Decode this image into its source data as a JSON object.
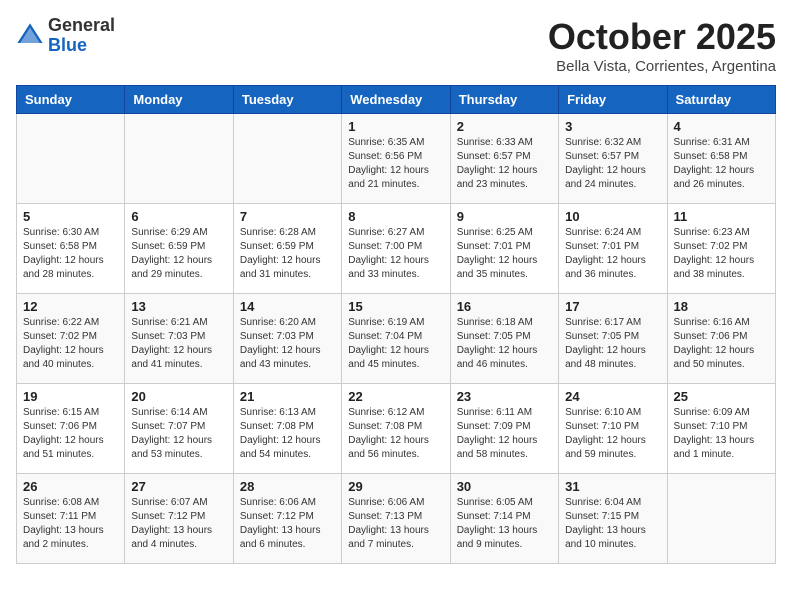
{
  "header": {
    "logo_line1": "General",
    "logo_line2": "Blue",
    "month": "October 2025",
    "location": "Bella Vista, Corrientes, Argentina"
  },
  "weekdays": [
    "Sunday",
    "Monday",
    "Tuesday",
    "Wednesday",
    "Thursday",
    "Friday",
    "Saturday"
  ],
  "weeks": [
    [
      {
        "day": "",
        "info": ""
      },
      {
        "day": "",
        "info": ""
      },
      {
        "day": "",
        "info": ""
      },
      {
        "day": "1",
        "info": "Sunrise: 6:35 AM\nSunset: 6:56 PM\nDaylight: 12 hours\nand 21 minutes."
      },
      {
        "day": "2",
        "info": "Sunrise: 6:33 AM\nSunset: 6:57 PM\nDaylight: 12 hours\nand 23 minutes."
      },
      {
        "day": "3",
        "info": "Sunrise: 6:32 AM\nSunset: 6:57 PM\nDaylight: 12 hours\nand 24 minutes."
      },
      {
        "day": "4",
        "info": "Sunrise: 6:31 AM\nSunset: 6:58 PM\nDaylight: 12 hours\nand 26 minutes."
      }
    ],
    [
      {
        "day": "5",
        "info": "Sunrise: 6:30 AM\nSunset: 6:58 PM\nDaylight: 12 hours\nand 28 minutes."
      },
      {
        "day": "6",
        "info": "Sunrise: 6:29 AM\nSunset: 6:59 PM\nDaylight: 12 hours\nand 29 minutes."
      },
      {
        "day": "7",
        "info": "Sunrise: 6:28 AM\nSunset: 6:59 PM\nDaylight: 12 hours\nand 31 minutes."
      },
      {
        "day": "8",
        "info": "Sunrise: 6:27 AM\nSunset: 7:00 PM\nDaylight: 12 hours\nand 33 minutes."
      },
      {
        "day": "9",
        "info": "Sunrise: 6:25 AM\nSunset: 7:01 PM\nDaylight: 12 hours\nand 35 minutes."
      },
      {
        "day": "10",
        "info": "Sunrise: 6:24 AM\nSunset: 7:01 PM\nDaylight: 12 hours\nand 36 minutes."
      },
      {
        "day": "11",
        "info": "Sunrise: 6:23 AM\nSunset: 7:02 PM\nDaylight: 12 hours\nand 38 minutes."
      }
    ],
    [
      {
        "day": "12",
        "info": "Sunrise: 6:22 AM\nSunset: 7:02 PM\nDaylight: 12 hours\nand 40 minutes."
      },
      {
        "day": "13",
        "info": "Sunrise: 6:21 AM\nSunset: 7:03 PM\nDaylight: 12 hours\nand 41 minutes."
      },
      {
        "day": "14",
        "info": "Sunrise: 6:20 AM\nSunset: 7:03 PM\nDaylight: 12 hours\nand 43 minutes."
      },
      {
        "day": "15",
        "info": "Sunrise: 6:19 AM\nSunset: 7:04 PM\nDaylight: 12 hours\nand 45 minutes."
      },
      {
        "day": "16",
        "info": "Sunrise: 6:18 AM\nSunset: 7:05 PM\nDaylight: 12 hours\nand 46 minutes."
      },
      {
        "day": "17",
        "info": "Sunrise: 6:17 AM\nSunset: 7:05 PM\nDaylight: 12 hours\nand 48 minutes."
      },
      {
        "day": "18",
        "info": "Sunrise: 6:16 AM\nSunset: 7:06 PM\nDaylight: 12 hours\nand 50 minutes."
      }
    ],
    [
      {
        "day": "19",
        "info": "Sunrise: 6:15 AM\nSunset: 7:06 PM\nDaylight: 12 hours\nand 51 minutes."
      },
      {
        "day": "20",
        "info": "Sunrise: 6:14 AM\nSunset: 7:07 PM\nDaylight: 12 hours\nand 53 minutes."
      },
      {
        "day": "21",
        "info": "Sunrise: 6:13 AM\nSunset: 7:08 PM\nDaylight: 12 hours\nand 54 minutes."
      },
      {
        "day": "22",
        "info": "Sunrise: 6:12 AM\nSunset: 7:08 PM\nDaylight: 12 hours\nand 56 minutes."
      },
      {
        "day": "23",
        "info": "Sunrise: 6:11 AM\nSunset: 7:09 PM\nDaylight: 12 hours\nand 58 minutes."
      },
      {
        "day": "24",
        "info": "Sunrise: 6:10 AM\nSunset: 7:10 PM\nDaylight: 12 hours\nand 59 minutes."
      },
      {
        "day": "25",
        "info": "Sunrise: 6:09 AM\nSunset: 7:10 PM\nDaylight: 13 hours\nand 1 minute."
      }
    ],
    [
      {
        "day": "26",
        "info": "Sunrise: 6:08 AM\nSunset: 7:11 PM\nDaylight: 13 hours\nand 2 minutes."
      },
      {
        "day": "27",
        "info": "Sunrise: 6:07 AM\nSunset: 7:12 PM\nDaylight: 13 hours\nand 4 minutes."
      },
      {
        "day": "28",
        "info": "Sunrise: 6:06 AM\nSunset: 7:12 PM\nDaylight: 13 hours\nand 6 minutes."
      },
      {
        "day": "29",
        "info": "Sunrise: 6:06 AM\nSunset: 7:13 PM\nDaylight: 13 hours\nand 7 minutes."
      },
      {
        "day": "30",
        "info": "Sunrise: 6:05 AM\nSunset: 7:14 PM\nDaylight: 13 hours\nand 9 minutes."
      },
      {
        "day": "31",
        "info": "Sunrise: 6:04 AM\nSunset: 7:15 PM\nDaylight: 13 hours\nand 10 minutes."
      },
      {
        "day": "",
        "info": ""
      }
    ]
  ]
}
